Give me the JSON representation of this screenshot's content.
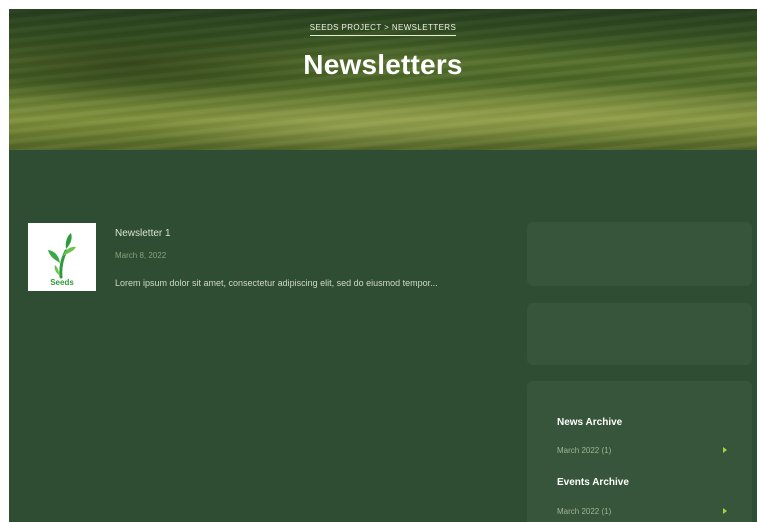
{
  "hero": {
    "breadcrumb": "SEEDS PROJECT > NEWSLETTERS",
    "title": "Newsletters"
  },
  "posts": [
    {
      "title": "Newsletter 1",
      "date": "March 8, 2022",
      "excerpt": "Lorem ipsum dolor sit amet, consectetur adipiscing elit, sed do eiusmod tempor...",
      "thumbnail_label": "Seeds"
    }
  ],
  "sidebar": {
    "news_archive": {
      "heading": "News Archive",
      "items": [
        {
          "label": "March 2022 (1)"
        }
      ]
    },
    "events_archive": {
      "heading": "Events Archive",
      "items": [
        {
          "label": "March 2022 (1)"
        }
      ]
    }
  },
  "colors": {
    "page_background": "#2f4d33",
    "widget_background": "#37553a",
    "accent_arrow": "#a4d23a",
    "logo_green": "#2e9a3b"
  },
  "icons": {
    "thumbnail": "seeds-logo-icon",
    "archive_bullet": "triangle-right-icon"
  }
}
